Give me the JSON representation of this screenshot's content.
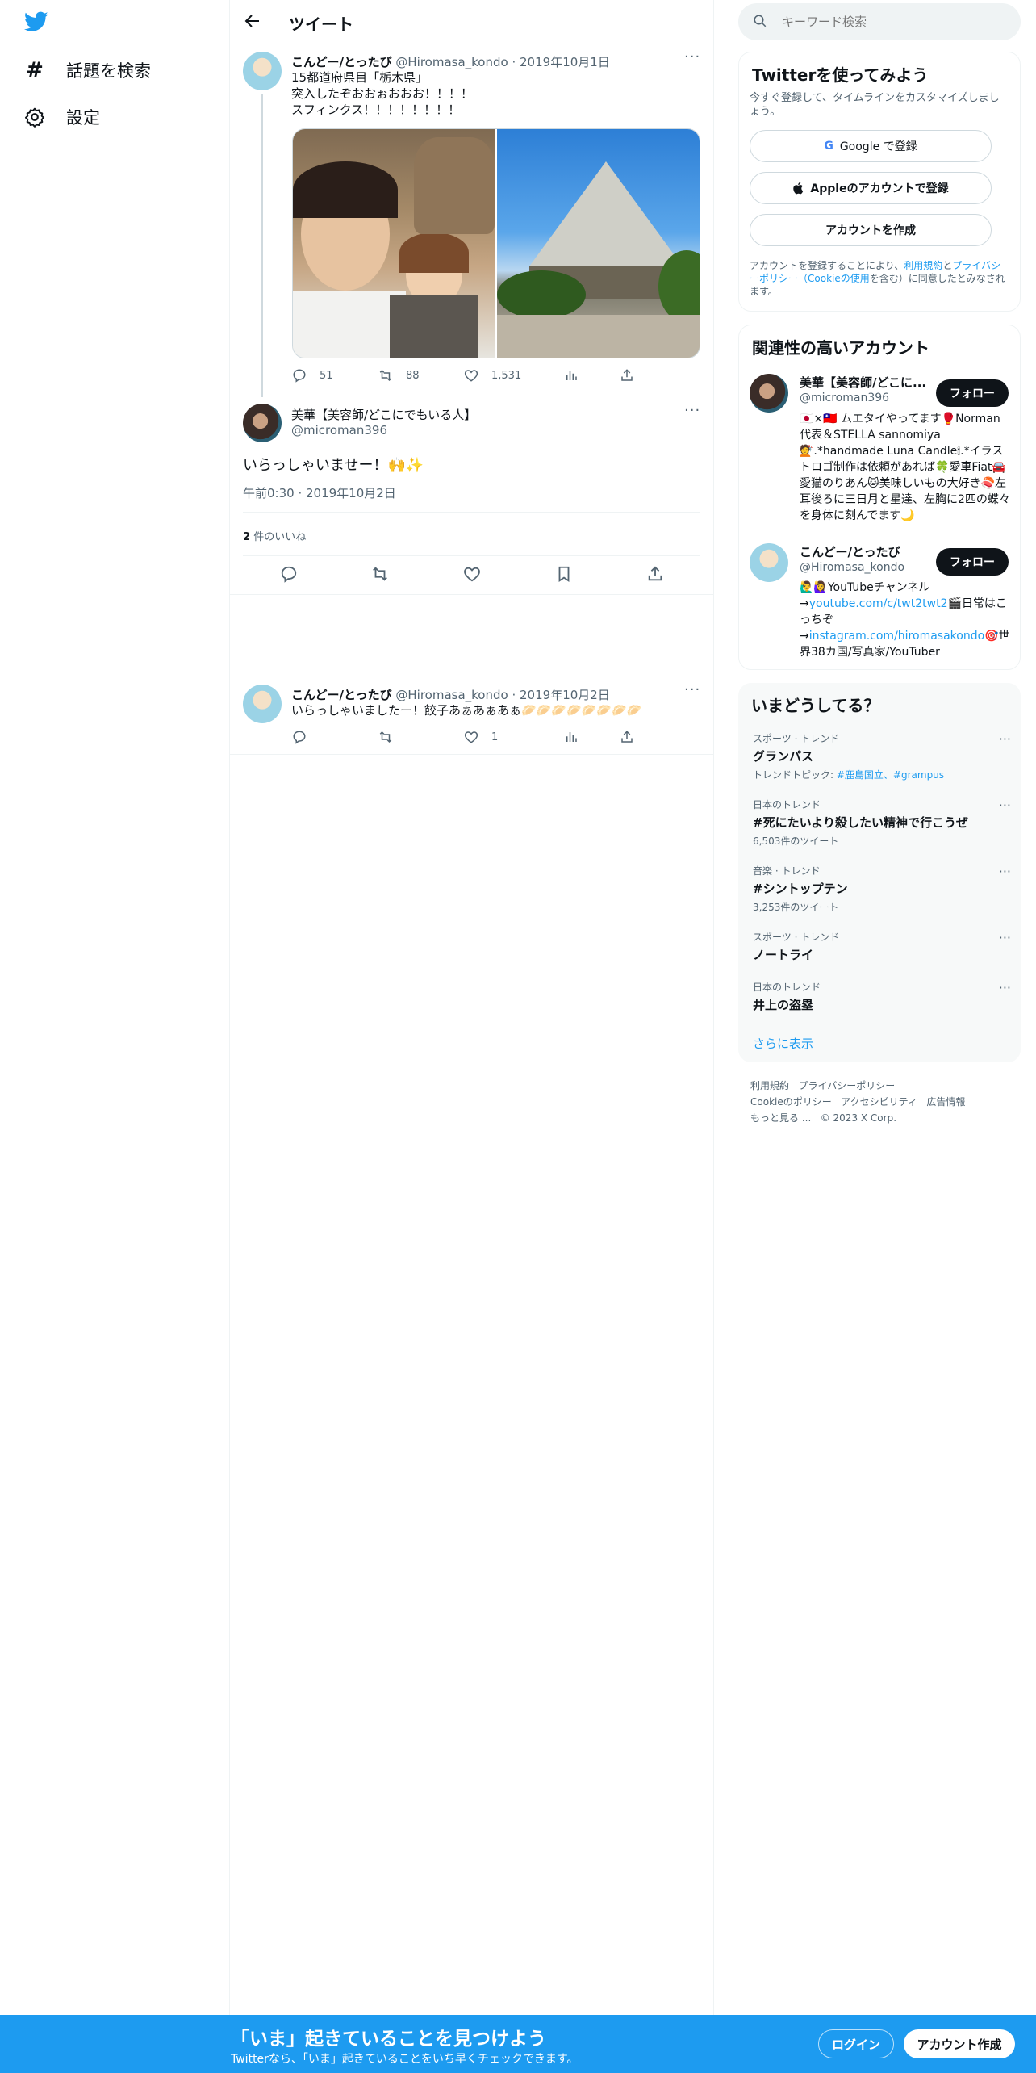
{
  "nav": {
    "explore_label": "話題を検索",
    "settings_label": "設定"
  },
  "header": {
    "title": "ツイート"
  },
  "parent_tweet": {
    "name": "こんどー/とったび",
    "handle": "@Hiromasa_kondo",
    "date": "2019年10月1日",
    "lines": [
      "15都道府県目「栃木県」",
      "突入したぞおおぉおおお！！！！",
      "スフィンクス！！！！！！！！"
    ],
    "replies": "51",
    "retweets": "88",
    "likes": "1,531"
  },
  "main_tweet": {
    "name": "美華【美容師/どこにでもいる人】",
    "handle": "@microman396",
    "text": "いらっしゃいませー！🙌✨",
    "timestamp": "午前0:30 · 2019年10月2日",
    "likes_count": "2",
    "likes_label": "件のいいね"
  },
  "reply_tweet": {
    "name": "こんどー/とったび",
    "handle": "@Hiromasa_kondo",
    "date": "2019年10月2日",
    "text": "いらっしゃいましたー！餃子あぁあぁあぁ🥟🥟🥟🥟🥟🥟🥟🥟",
    "likes": "1"
  },
  "search": {
    "placeholder": "キーワード検索"
  },
  "signup": {
    "title": "Twitterを使ってみよう",
    "subtitle": "今すぐ登録して、タイムラインをカスタマイズしましょう。",
    "google_label": "Google で登録",
    "apple_label": "Appleのアカウントで登録",
    "create_label": "アカウントを作成",
    "legal_prefix": "アカウントを登録することにより、",
    "terms_link": "利用規約",
    "and": "と",
    "privacy_link": "プライバシーポリシー",
    "cookie_open": "（",
    "cookie_link": "Cookieの使用",
    "legal_suffix": "を含む）に同意したとみなされます。"
  },
  "related": {
    "title": "関連性の高いアカウント",
    "follow_label": "フォロー",
    "accounts": [
      {
        "name": "美華【美容師/どこに...",
        "handle": "@microman396",
        "bio": "🇯🇵×🇹🇼 ムエタイやってます🥊Norman代表＆STELLA sannomiya💇.*handmade Luna Candle🕯.*イラストロゴ制作は依頼があれば🍀愛車Fiat🚘愛猫のりあん🐱美味しいもの大好き🍣左耳後ろに三日月と星達、左胸に2匹の蝶々を身体に刻んでます🌙"
      },
      {
        "name": "こんどー/とったび",
        "handle": "@Hiromasa_kondo",
        "bio_1": "🙋‍♂️🙋‍♀️YouTubeチャンネル→",
        "bio_link_1": "youtube.com/c/twt2twt2",
        "bio_2": "🎬日常はこっちぞ→",
        "bio_link_2": "instagram.com/hiromasakondo",
        "bio_3": "🎯世界38カ国/写真家/YouTuber"
      }
    ]
  },
  "trends": {
    "title": "いまどうしてる？",
    "items": [
      {
        "category": "スポーツ · トレンド",
        "name": "グランパス",
        "sub_prefix": "トレンドトピック: ",
        "sub_link": "#鹿島国立、#grampus"
      },
      {
        "category": "日本のトレンド",
        "name": "#死にたいより殺したい精神で行こうぜ",
        "sub": "6,503件のツイート"
      },
      {
        "category": "音楽 · トレンド",
        "name": "#シントップテン",
        "sub": "3,253件のツイート"
      },
      {
        "category": "スポーツ · トレンド",
        "name": "ノートライ"
      },
      {
        "category": "日本のトレンド",
        "name": "井上の盗塁"
      }
    ],
    "show_more": "さらに表示"
  },
  "footer": {
    "terms": "利用規約",
    "privacy": "プライバシーポリシー",
    "cookie": "Cookieのポリシー",
    "accessibility": "アクセシビリティ",
    "ads": "広告情報",
    "more": "もっと見る ...",
    "copyright": "© 2023 X Corp."
  },
  "bottom_bar": {
    "title": "「いま」起きていることを見つけよう",
    "subtitle": "Twitterなら、「いま」起きていることをいち早くチェックできます。",
    "login_label": "ログイン",
    "signup_label": "アカウント作成"
  },
  "colors": {
    "accent": "#1d9bf0",
    "text": "#0f1419",
    "muted": "#536471"
  }
}
